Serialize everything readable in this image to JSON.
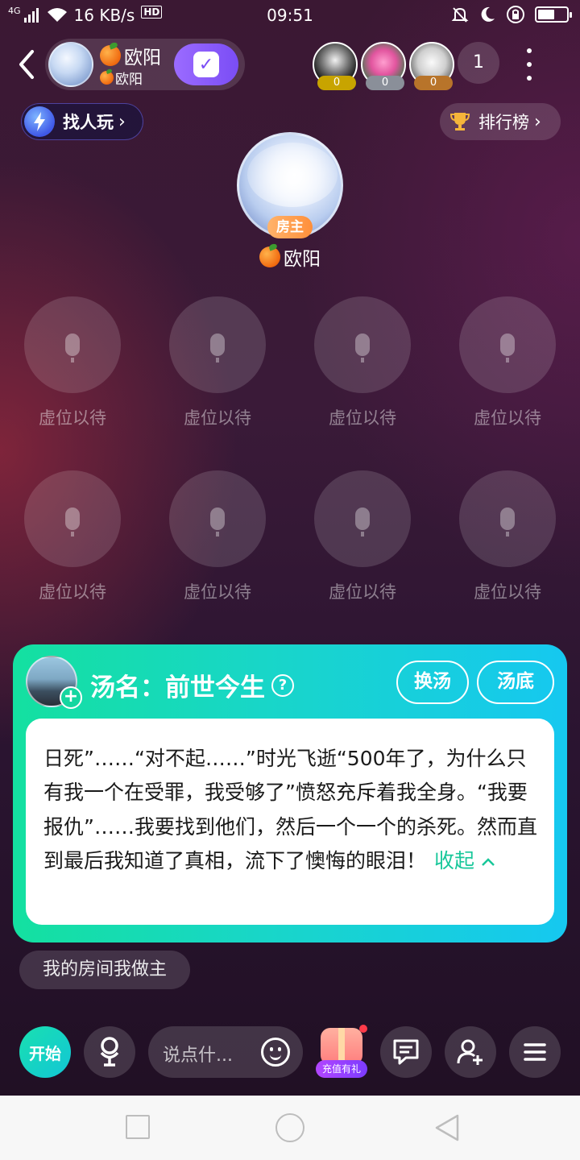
{
  "status_bar": {
    "network": "4G",
    "speed": "16 KB/s",
    "hd": "HD",
    "time": "09:51",
    "icons": [
      "signal-icon",
      "wifi-icon",
      "mute-bell-icon",
      "moon-icon",
      "lock-rotate-icon",
      "battery-icon"
    ]
  },
  "header": {
    "room_name": "欧阳",
    "room_owner": "欧阳",
    "audience": [
      {
        "count": "0",
        "badge_color": "#c8a400"
      },
      {
        "count": "0",
        "badge_color": "#8a8f99"
      },
      {
        "count": "0",
        "badge_color": "#b8742a"
      }
    ],
    "online_count": "1"
  },
  "actions": {
    "find_players": "找人玩",
    "leaderboard": "排行榜"
  },
  "host": {
    "badge": "房主",
    "name": "欧阳"
  },
  "seats": [
    {
      "label": "虚位以待"
    },
    {
      "label": "虚位以待"
    },
    {
      "label": "虚位以待"
    },
    {
      "label": "虚位以待"
    },
    {
      "label": "虚位以待"
    },
    {
      "label": "虚位以待"
    },
    {
      "label": "虚位以待"
    },
    {
      "label": "虚位以待"
    }
  ],
  "soup_card": {
    "title": "汤名：前世今生",
    "help": "?",
    "change_button": "换汤",
    "answer_button": "汤底",
    "text": "日死”……“对不起……”时光飞逝“500年了，为什么只有我一个在受罪，我受够了”愤怒充斥着我全身。“我要报仇”……我要找到他们，然后一个一个的杀死。然而直到最后我知道了真相，流下了懊悔的眼泪！",
    "collapse": "收起"
  },
  "message_pill": "我的房间我做主",
  "toolbar": {
    "start": "开始",
    "chat_placeholder": "说点什...",
    "gift_label": "充值有礼"
  },
  "colors": {
    "accent_green": "#18c79a",
    "accent_purple": "#7a4df5",
    "card_gradient_start": "#14e0a0",
    "card_gradient_end": "#16c8f0"
  }
}
